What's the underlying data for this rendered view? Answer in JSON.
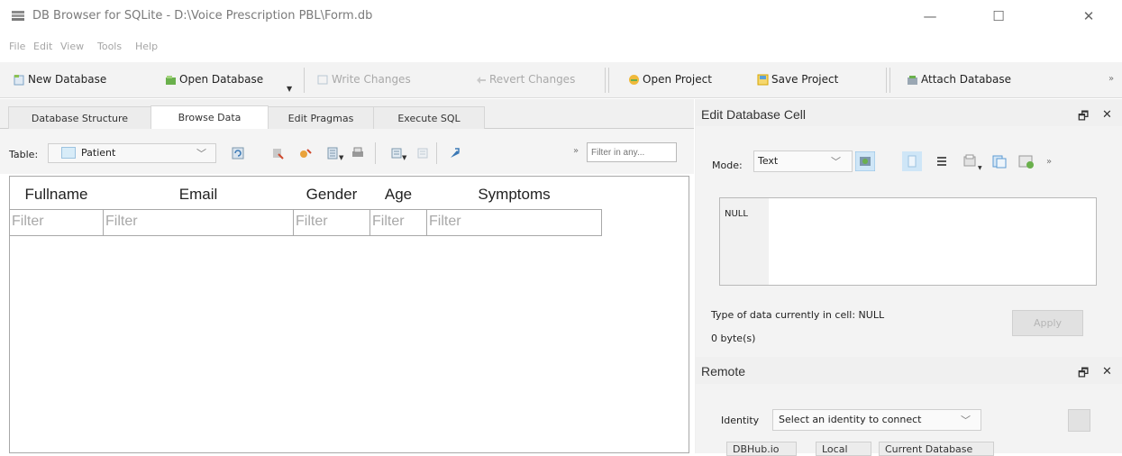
{
  "window": {
    "title": "DB Browser for SQLite - D:\\Voice Prescription PBL\\Form.db",
    "minimize": "—",
    "maximize": "☐",
    "close": "✕"
  },
  "menu": [
    "File",
    "Edit",
    "View",
    "Tools",
    "Help"
  ],
  "toolbar": {
    "new_database": "New Database",
    "open_database": "Open Database",
    "write_changes": "Write Changes",
    "revert_changes": "Revert Changes",
    "open_project": "Open Project",
    "save_project": "Save Project",
    "attach_database": "Attach Database",
    "overflow": "»"
  },
  "tabs": [
    "Database Structure",
    "Browse Data",
    "Edit Pragmas",
    "Execute SQL"
  ],
  "active_tab": "Browse Data",
  "browse": {
    "table_label": "Table:",
    "table_value": "Patient",
    "filter_placeholder": "Filter in any...",
    "overflow": "»",
    "columns": [
      "Fullname",
      "Email",
      "Gender",
      "Age",
      "Symptoms"
    ],
    "filter_text": "Filter"
  },
  "edit_cell": {
    "title": "Edit Database Cell",
    "float_icon": "🗗",
    "close_icon": "✕",
    "mode_label": "Mode:",
    "mode_value": "Text",
    "overflow": "»",
    "cell_value": "NULL",
    "type_info": "Type of data currently in cell: NULL",
    "size_info": "0 byte(s)",
    "apply": "Apply"
  },
  "remote": {
    "title": "Remote",
    "float_icon": "🗗",
    "close_icon": "✕",
    "identity_label": "Identity",
    "identity_value": "Select an identity to connect",
    "tabs": [
      "DBHub.io",
      "Local",
      "Current Database"
    ]
  },
  "colors": {
    "toolbar_bg": "#f3f3f3",
    "pane_bg": "#f0f0f0",
    "disabled_text": "#a9a9a9",
    "accent_blue": "#cfe6f7"
  }
}
